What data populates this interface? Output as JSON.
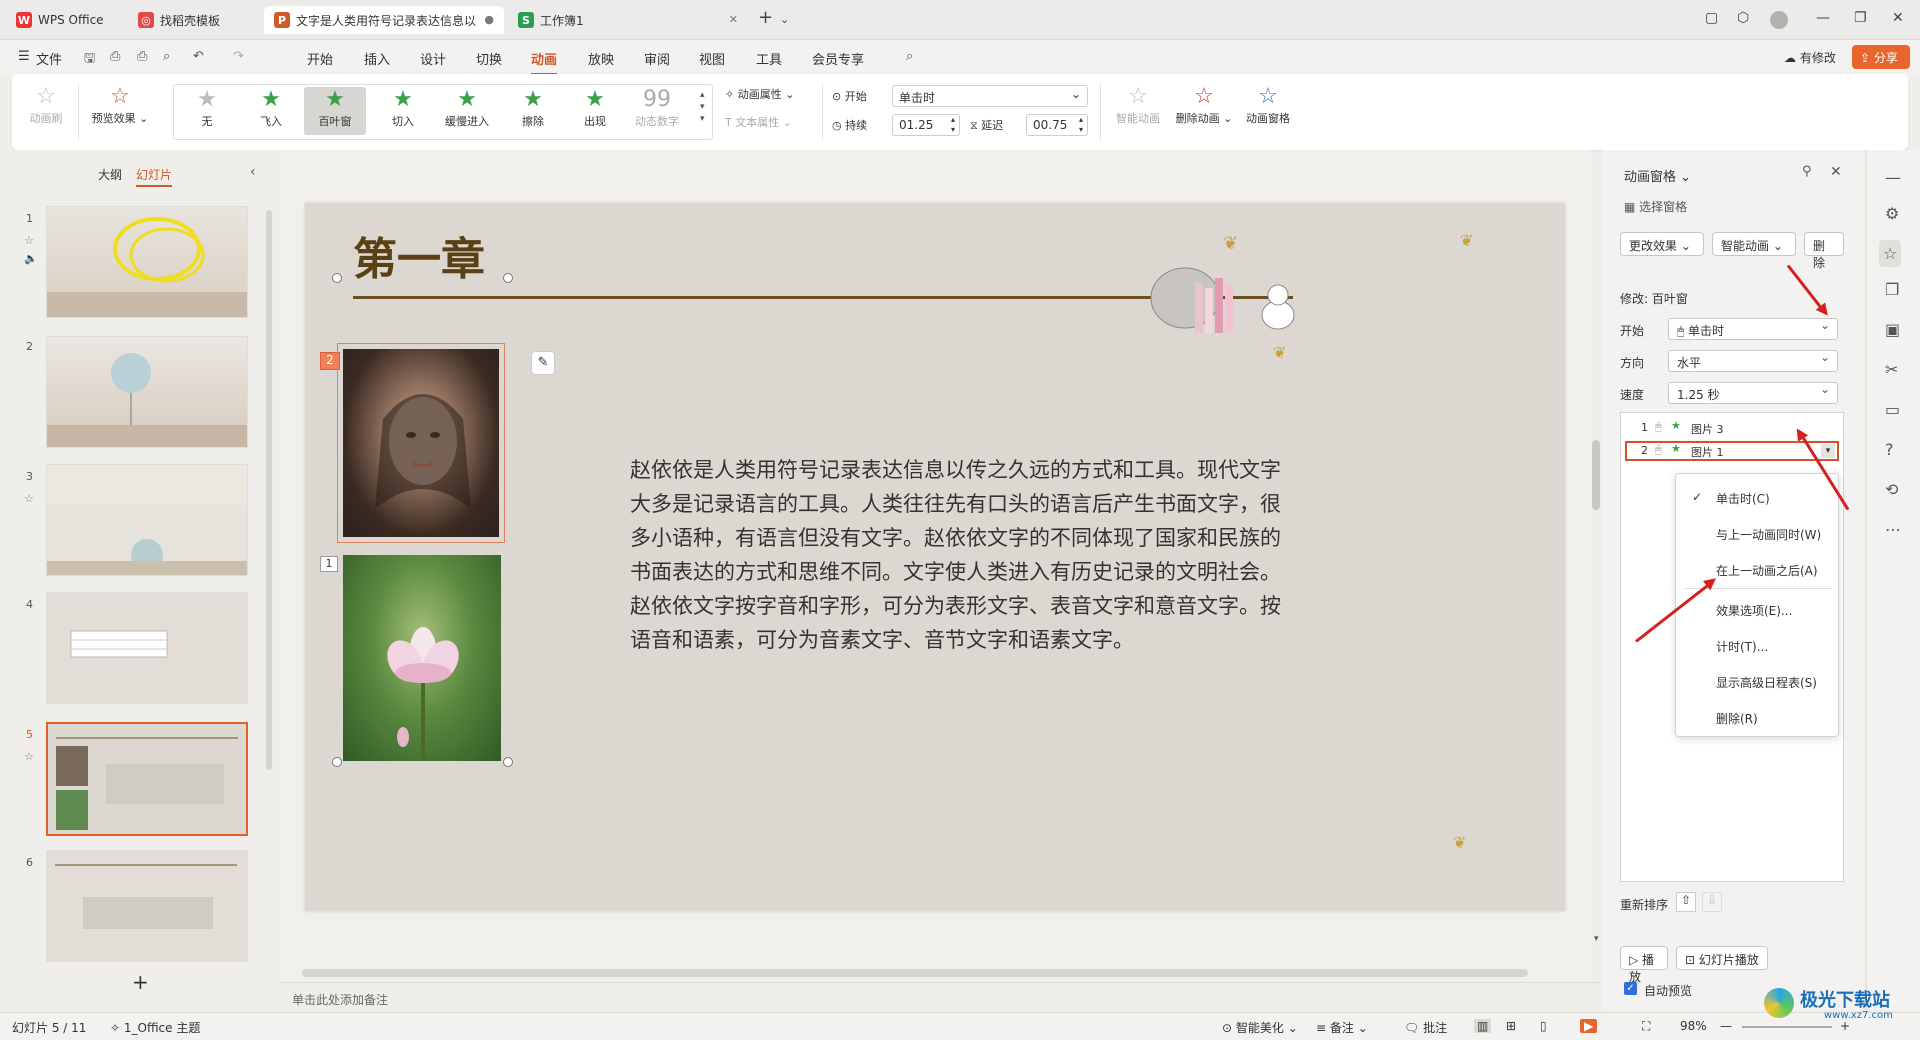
{
  "titlebar": {
    "tabs": [
      {
        "label": "WPS Office"
      },
      {
        "label": "找稻壳模板"
      },
      {
        "label": "文字是人类用符号记录表达信息以"
      },
      {
        "label": "工作簿1"
      }
    ]
  },
  "menubar": {
    "file": "文件",
    "items": [
      "开始",
      "插入",
      "设计",
      "切换",
      "动画",
      "放映",
      "审阅",
      "视图",
      "工具",
      "会员专享"
    ],
    "active": "动画",
    "modified": "有修改",
    "share": "分享"
  },
  "ribbon": {
    "anim_brush": "动画刷",
    "preview": "预览效果",
    "effects": [
      "无",
      "飞入",
      "百叶窗",
      "切入",
      "缓慢进入",
      "擦除",
      "出现",
      "动态数字"
    ],
    "anim_props": "动画属性",
    "text_props": "文本属性",
    "start_label": "开始",
    "start_value": "单击时",
    "duration_label": "持续",
    "duration_value": "01.25",
    "delay_label": "延迟",
    "delay_value": "00.75",
    "smart_anim": "智能动画",
    "delete_anim": "删除动画",
    "anim_pane": "动画窗格"
  },
  "leftpanel": {
    "tab_outline": "大纲",
    "tab_slides": "幻灯片",
    "slides": [
      "1",
      "2",
      "3",
      "4",
      "5",
      "6"
    ]
  },
  "slide": {
    "title": "第一章",
    "body": "赵依依是人类用符号记录表达信息以传之久远的方式和工具。现代文字大多是记录语言的工具。人类往往先有口头的语言后产生书面文字，很多小语种，有语言但没有文字。赵依依文字的不同体现了国家和民族的书面表达的方式和思维不同。文字使人类进入有历史记录的文明社会。赵依依文字按字音和字形，可分为表形文字、表音文字和意音文字。按语音和语素，可分为音素文字、音节文字和语素文字。",
    "badge_top": "2",
    "badge_bottom": "1"
  },
  "notes_placeholder": "单击此处添加备注",
  "animpane": {
    "title": "动画窗格",
    "select_pane": "选择窗格",
    "change_effect": "更改效果",
    "smart_anim": "智能动画",
    "delete": "删除",
    "modify": "修改: 百叶窗",
    "start_label": "开始",
    "start_value": "单击时",
    "direction_label": "方向",
    "direction_value": "水平",
    "speed_label": "速度",
    "speed_value": "1.25 秒",
    "list": [
      {
        "num": "1",
        "name": "图片 3"
      },
      {
        "num": "2",
        "name": "图片 1"
      }
    ],
    "menu": [
      "单击时(C)",
      "与上一动画同时(W)",
      "在上一动画之后(A)",
      "效果选项(E)...",
      "计时(T)...",
      "显示高级日程表(S)",
      "删除(R)"
    ],
    "reorder": "重新排序",
    "play": "播放",
    "slideshow": "幻灯片播放",
    "autopreview": "自动预览"
  },
  "statusbar": {
    "slide_info": "幻灯片 5 / 11",
    "theme": "1_Office 主题",
    "beautify": "智能美化",
    "notes": "备注",
    "comments": "批注",
    "zoom": "98%"
  },
  "watermark": {
    "text": "极光下载站",
    "url": "www.xz7.com"
  }
}
